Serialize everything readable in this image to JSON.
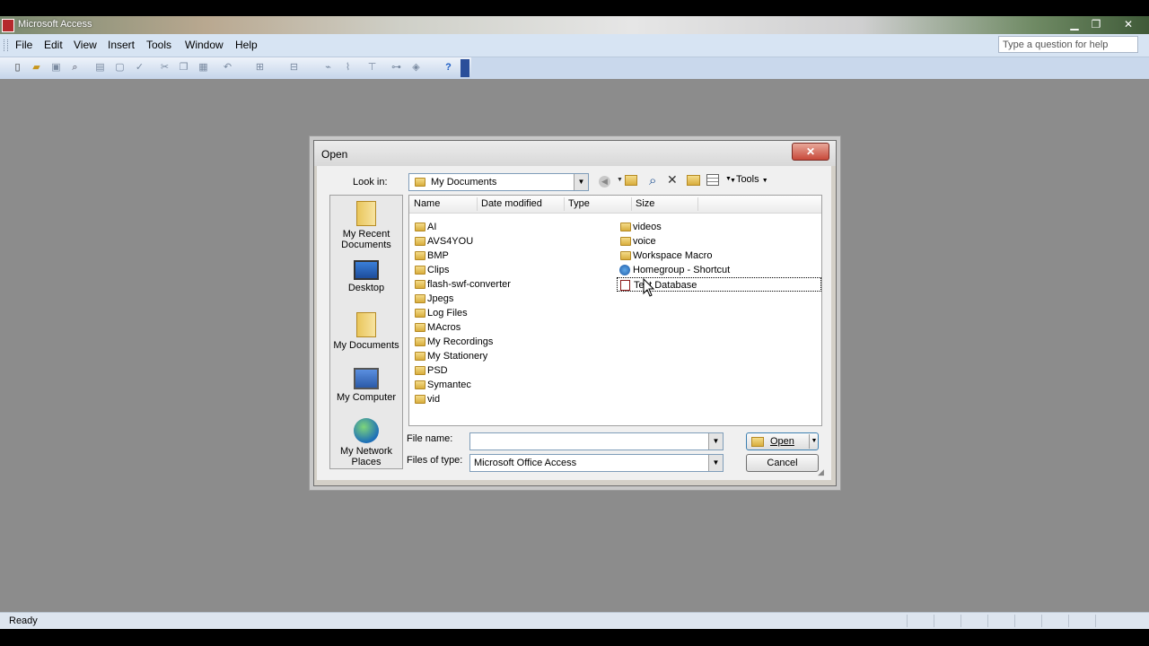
{
  "window": {
    "title": "Microsoft Access",
    "minimize": "▁",
    "restore": "❐",
    "close": "✕"
  },
  "menu": [
    "File",
    "Edit",
    "View",
    "Insert",
    "Tools",
    "Window",
    "Help"
  ],
  "help_box": {
    "placeholder": "Type a question for help"
  },
  "status": {
    "text": "Ready"
  },
  "dialog": {
    "title": "Open",
    "close": "✕",
    "look_in_label": "Look in:",
    "look_in_value": "My Documents",
    "tools_label": "Tools",
    "places": [
      {
        "label": "My Recent Documents",
        "icon": "recent-documents-icon"
      },
      {
        "label": "Desktop",
        "icon": "desktop-icon"
      },
      {
        "label": "My Documents",
        "icon": "my-documents-icon"
      },
      {
        "label": "My Computer",
        "icon": "my-computer-icon"
      },
      {
        "label": "My Network Places",
        "icon": "network-places-icon"
      }
    ],
    "columns": [
      "Name",
      "Date modified",
      "Type",
      "Size"
    ],
    "files_col1": [
      "AI",
      "AVS4YOU",
      "BMP",
      "Clips",
      "flash-swf-converter",
      "Jpegs",
      "Log Files",
      "MAcros",
      "My Recordings",
      "My Stationery",
      "PSD",
      "Symantec",
      "vid"
    ],
    "files_col2": [
      {
        "name": "videos",
        "kind": "folder"
      },
      {
        "name": "voice",
        "kind": "folder"
      },
      {
        "name": "Workspace Macro",
        "kind": "folder"
      },
      {
        "name": "Homegroup - Shortcut",
        "kind": "shortcut"
      },
      {
        "name": "Test Database",
        "kind": "access-database",
        "selected": true
      }
    ],
    "file_name_label": "File name:",
    "file_name_value": "",
    "files_of_type_label": "Files of type:",
    "files_of_type_value": "Microsoft Office Access",
    "open_button": "Open",
    "cancel_button": "Cancel"
  }
}
